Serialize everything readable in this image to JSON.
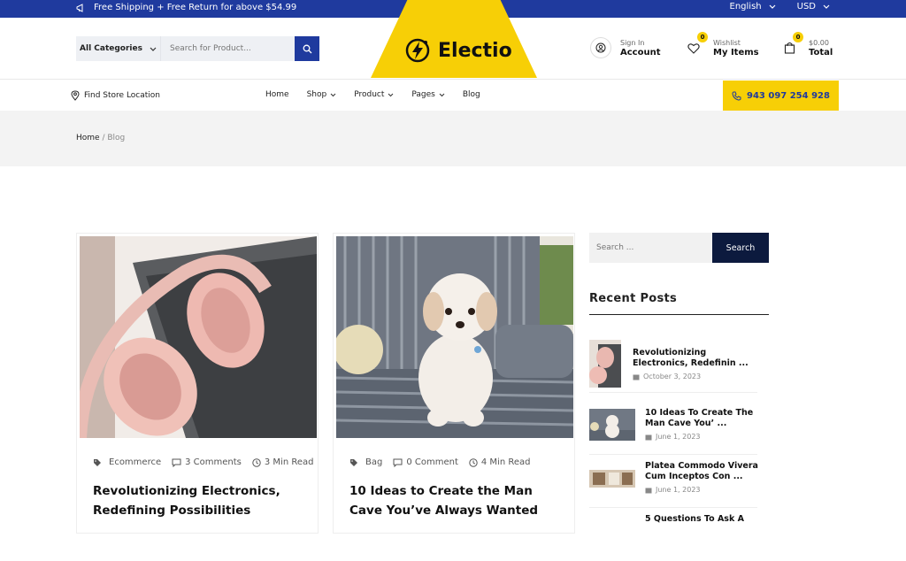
{
  "topbar": {
    "promo": "Free Shipping + Free Return for above $54.99",
    "language": "English",
    "currency": "USD"
  },
  "header": {
    "category_label": "All Categories",
    "search_placeholder": "Search for Product...",
    "logo_text": "Electio",
    "account": {
      "small": "Sign In",
      "big": "Account"
    },
    "wishlist": {
      "small": "Wishlist",
      "big": "My Items",
      "count": "0"
    },
    "cart": {
      "small": "$0.00",
      "big": "Total",
      "count": "0"
    }
  },
  "nav": {
    "store_locator": "Find Store Location",
    "items": [
      "Home",
      "Shop",
      "Product",
      "Pages",
      "Blog"
    ],
    "phone": "943 097 254 928"
  },
  "breadcrumb": {
    "home": "Home",
    "sep": " / ",
    "current": "Blog"
  },
  "posts": [
    {
      "category": "Ecommerce",
      "comments": "3 Comments",
      "read": "3 Min Read",
      "title": "Revolutionizing Electronics, Redefining Possibilities"
    },
    {
      "category": "Bag",
      "comments": "0 Comment",
      "read": "4 Min Read",
      "title": "10 Ideas to Create the Man Cave You’ve Always Wanted"
    }
  ],
  "sidebar": {
    "search_placeholder": "Search ...",
    "search_button": "Search",
    "recent_title": "Recent Posts",
    "recent": [
      {
        "title": "Revolutionizing Electronics, Redefinin ...",
        "date": "October 3, 2023"
      },
      {
        "title": "10 Ideas To Create The Man Cave You’ ...",
        "date": "June 1, 2023"
      },
      {
        "title": "Platea Commodo Vivera Cum Inceptos Con ...",
        "date": "June 1, 2023"
      },
      {
        "title": "5 Questions To Ask A",
        "date": ""
      }
    ]
  },
  "colors": {
    "brand_blue": "#1f3a9e",
    "brand_yellow": "#f7cf06",
    "dark_navy": "#0c1a3e"
  }
}
